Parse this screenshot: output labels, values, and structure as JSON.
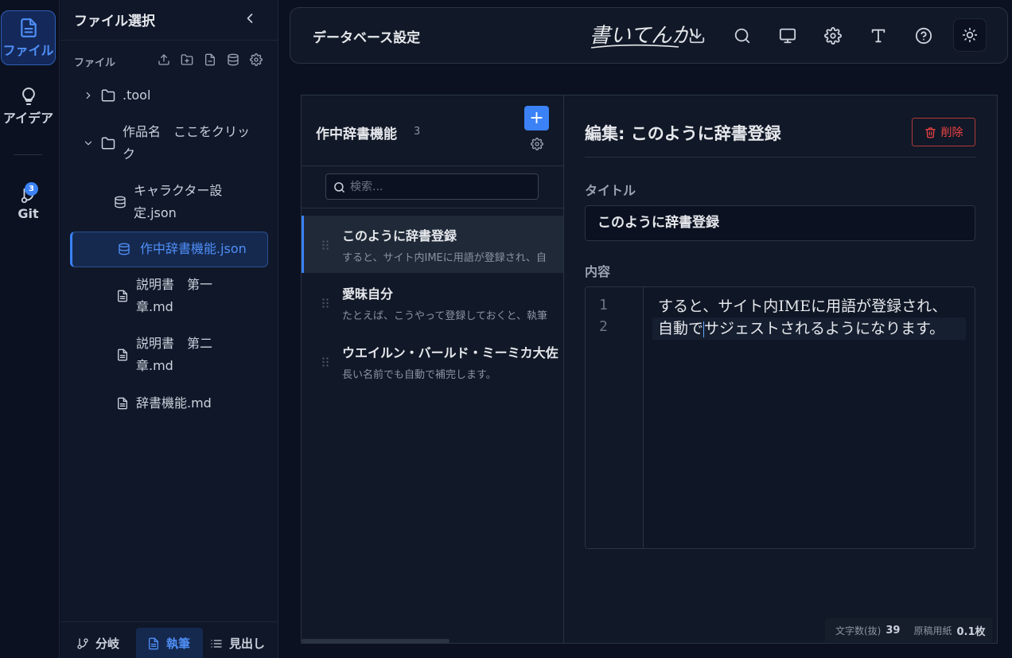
{
  "activity": {
    "files_label": "ファイル",
    "ideas_label": "アイデア",
    "git_label": "Git",
    "git_badge": "3"
  },
  "sidebar": {
    "title": "ファイル選択",
    "subtitle": "ファイル",
    "tree": [
      {
        "label": ".tool",
        "type": "folder"
      },
      {
        "label": "作品名　ここをクリック",
        "type": "folder"
      },
      {
        "label": "キャラクター設定.json",
        "type": "db"
      },
      {
        "label": "作中辞書機能.json",
        "type": "db",
        "active": true
      },
      {
        "label": "説明書　第一章.md",
        "type": "file"
      },
      {
        "label": "説明書　第二章.md",
        "type": "file"
      },
      {
        "label": "辞書機能.md",
        "type": "file"
      }
    ],
    "footer": {
      "branch": "分岐",
      "write": "執筆",
      "outline": "見出し"
    }
  },
  "topbar": {
    "title": "データベース設定",
    "logo_text": "書いてんか"
  },
  "list": {
    "title": "作中辞書機能",
    "count": "3",
    "add_label": "+",
    "search_placeholder": "検索...",
    "entries": [
      {
        "title": "このように辞書登録",
        "desc": "すると、サイト内IMEに用語が登録され、自"
      },
      {
        "title": "愛昧自分",
        "desc": "たとえば、こうやって登録しておくと、執筆"
      },
      {
        "title": "ウエイルン・バールド・ミーミカ大佐",
        "desc": "長い名前でも自動で補完します。"
      }
    ]
  },
  "editor": {
    "heading": "編集: このように辞書登録",
    "delete_label": "削除",
    "title_label": "タイトル",
    "title_value": "このように辞書登録",
    "content_label": "内容",
    "lines": [
      {
        "num": "1",
        "text": "すると、サイト内IMEに用語が登録され、"
      },
      {
        "num": "2",
        "text_before": "自動で",
        "text_after": "サジェストされるようになります。"
      }
    ]
  },
  "status": {
    "chars_label": "文字数(抜)",
    "chars_value": "39",
    "paper_label": "原稿用紙",
    "paper_value": "0.1枚"
  }
}
